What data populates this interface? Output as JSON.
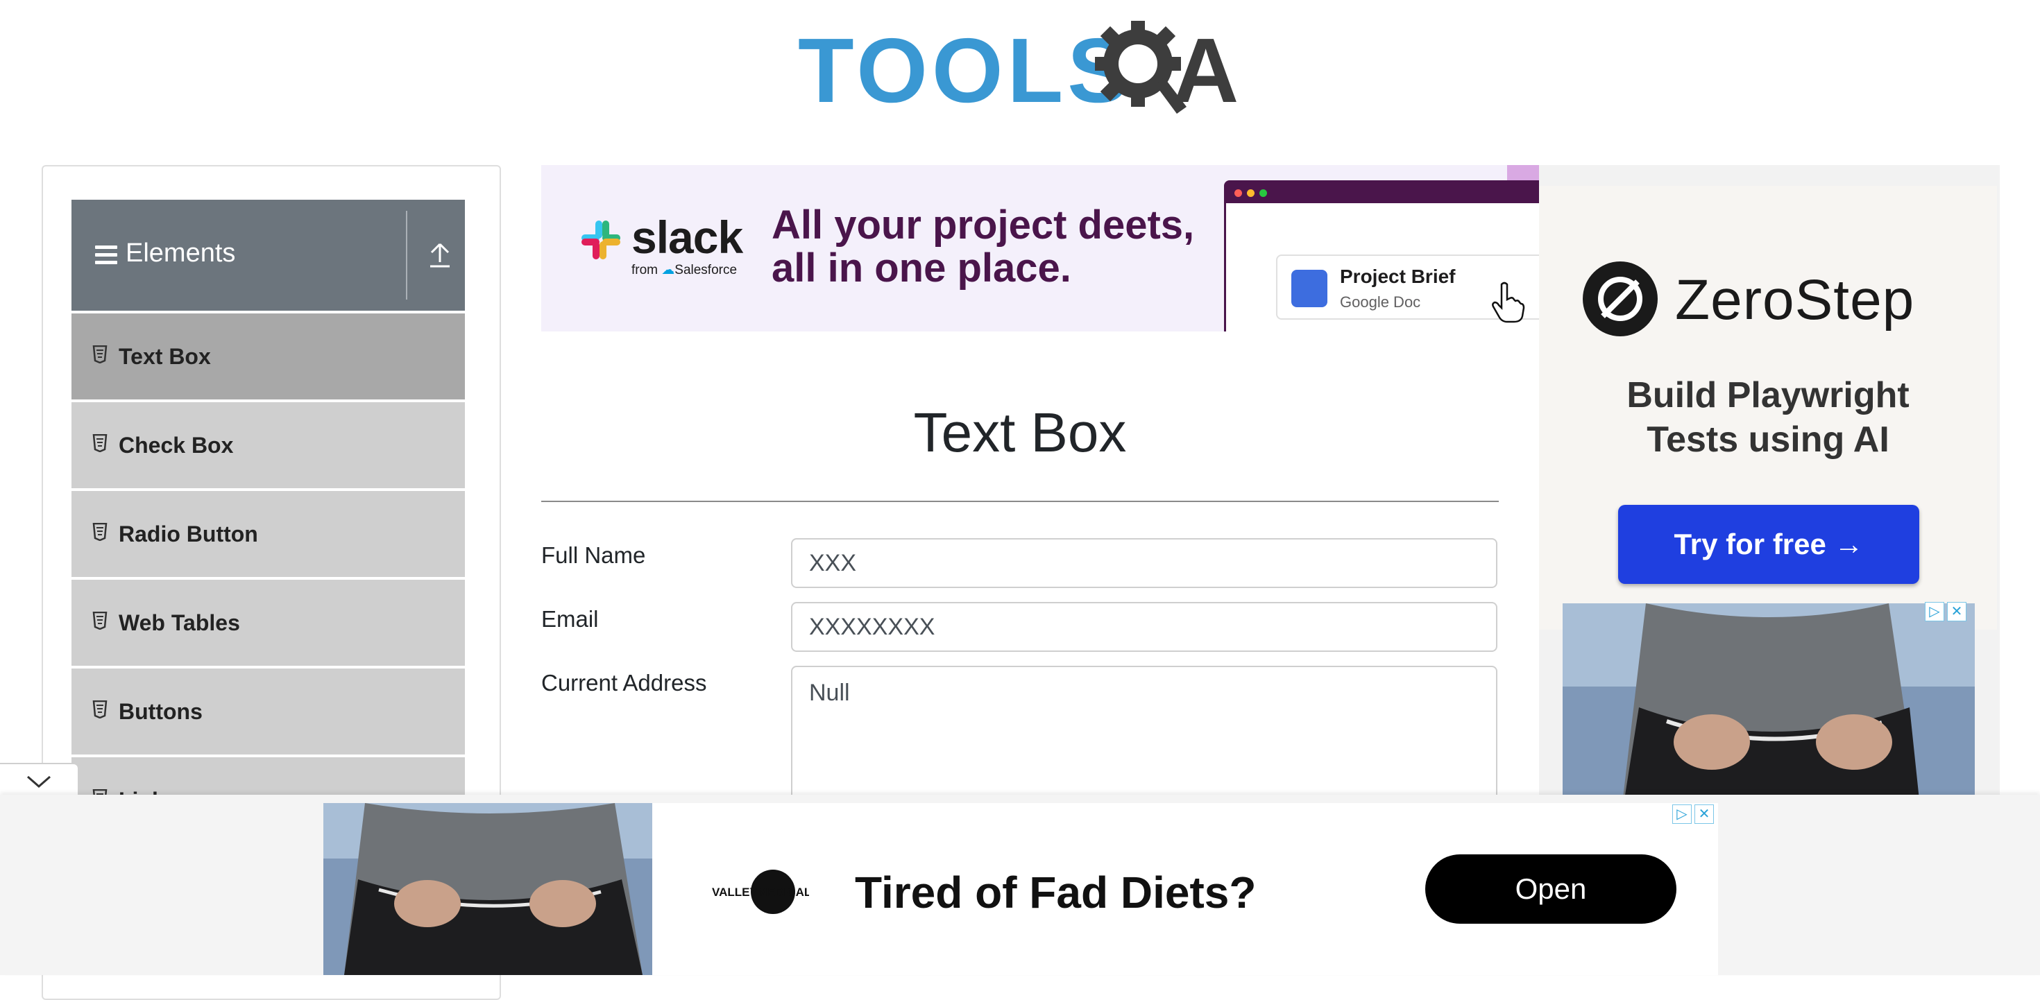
{
  "logo": {
    "text": "TOOLS",
    "letter_a": "A",
    "alt": "ToolsQA"
  },
  "sidebar": {
    "group_title": "Elements",
    "items": [
      {
        "label": "Text Box",
        "active": true
      },
      {
        "label": "Check Box",
        "active": false
      },
      {
        "label": "Radio Button",
        "active": false
      },
      {
        "label": "Web Tables",
        "active": false
      },
      {
        "label": "Buttons",
        "active": false
      },
      {
        "label": "Links",
        "active": false
      }
    ]
  },
  "top_ad": {
    "brand": "slack",
    "from": "from",
    "from_brand": "Salesforce",
    "headline_line1": "All your project deets,",
    "headline_line2": "all in one place.",
    "doc_title": "Project Brief",
    "doc_subtitle": "Google Doc"
  },
  "main": {
    "title": "Text Box",
    "fields": {
      "full_name_label": "Full Name",
      "full_name_value": "XXX",
      "email_label": "Email",
      "email_value": "XXXXXXXX",
      "current_address_label": "Current Address",
      "current_address_value": "Null"
    }
  },
  "right_ad": {
    "brand": "ZeroStep",
    "subtitle_line1": "Build Playwright",
    "subtitle_line2": "Tests using AI",
    "cta": "Try for free →"
  },
  "bottom_ad": {
    "logo_text": "VALLEYMEDICAL",
    "headline": "Tired of Fad Diets?",
    "cta": "Open"
  },
  "ad_marks": {
    "info": "▷",
    "close": "✕"
  },
  "colors": {
    "sidebar_header": "#6c757d",
    "menu_item": "#cfcfcf",
    "menu_item_active": "#a8a8a8",
    "logo_blue": "#3a98d3",
    "slack_purple": "#4a154b",
    "zerostep_button": "#1f3fe0"
  }
}
